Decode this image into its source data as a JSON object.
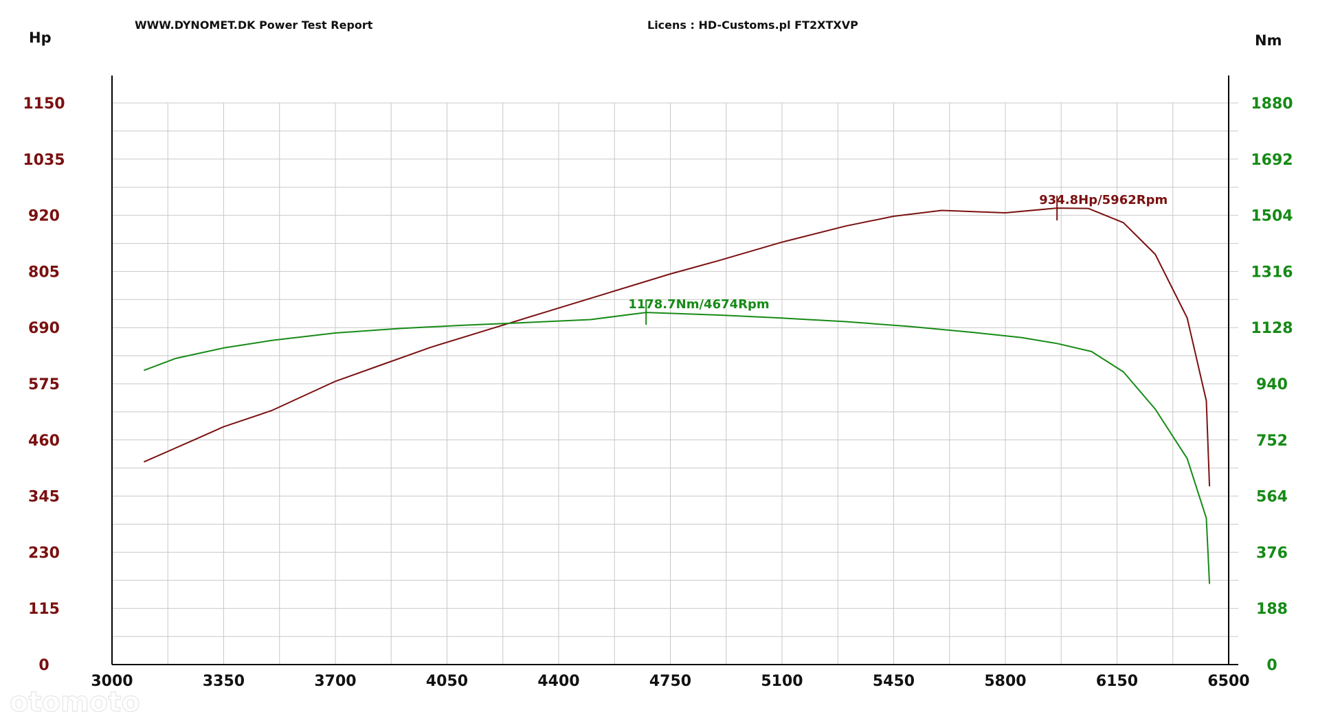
{
  "header": {
    "left_title": "WWW.DYNOMET.DK  Power Test Report",
    "license": "Licens :  HD-Customs.pl  FT2XTXVP"
  },
  "watermark": "otomoto",
  "colors": {
    "power": "#7a1010",
    "torque": "#168a16",
    "grid": "#c8c8c8",
    "axis": "#000000"
  },
  "chart_data": {
    "type": "line",
    "x_label": "",
    "x_unit": "Rpm",
    "x_ticks": [
      3000,
      3350,
      3700,
      4050,
      4400,
      4750,
      5100,
      5450,
      5800,
      6150,
      6500
    ],
    "x_range": [
      3000,
      6500
    ],
    "y_left": {
      "unit": "Hp",
      "range": [
        0,
        1150
      ],
      "ticks": [
        0,
        115,
        230,
        345,
        460,
        575,
        690,
        805,
        920,
        1035,
        1150
      ]
    },
    "y_right": {
      "unit": "Nm",
      "range": [
        0,
        1880
      ],
      "ticks": [
        0,
        188,
        376,
        564,
        752,
        940,
        1128,
        1316,
        1504,
        1692,
        1880
      ]
    },
    "grid": true,
    "series": [
      {
        "name": "Hp",
        "axis": "left",
        "x": [
          3100,
          3250,
          3350,
          3500,
          3700,
          3820,
          4000,
          4200,
          4400,
          4550,
          4750,
          4900,
          5100,
          5300,
          5450,
          5600,
          5800,
          5962,
          6060,
          6170,
          6270,
          6370,
          6430,
          6440
        ],
        "y": [
          415,
          458,
          487,
          520,
          580,
          608,
          650,
          690,
          730,
          760,
          800,
          827,
          865,
          898,
          918,
          930,
          925,
          934.8,
          934,
          905,
          840,
          710,
          540,
          365
        ]
      },
      {
        "name": "Nm",
        "axis": "right",
        "x": [
          3100,
          3200,
          3350,
          3500,
          3700,
          3900,
          4100,
          4300,
          4500,
          4674,
          4900,
          5100,
          5300,
          5500,
          5700,
          5850,
          5962,
          6070,
          6170,
          6270,
          6370,
          6430,
          6440
        ],
        "y": [
          985,
          1025,
          1060,
          1085,
          1110,
          1125,
          1136,
          1145,
          1155,
          1178.7,
          1170,
          1160,
          1148,
          1132,
          1112,
          1095,
          1075,
          1048,
          980,
          855,
          690,
          490,
          270
        ]
      }
    ],
    "annotations": [
      {
        "series": "Hp",
        "x": 5962,
        "y": 934.8,
        "label": "934.8Hp/5962Rpm"
      },
      {
        "series": "Nm",
        "x": 4674,
        "y": 1178.7,
        "label": "1178.7Nm/4674Rpm"
      }
    ]
  }
}
